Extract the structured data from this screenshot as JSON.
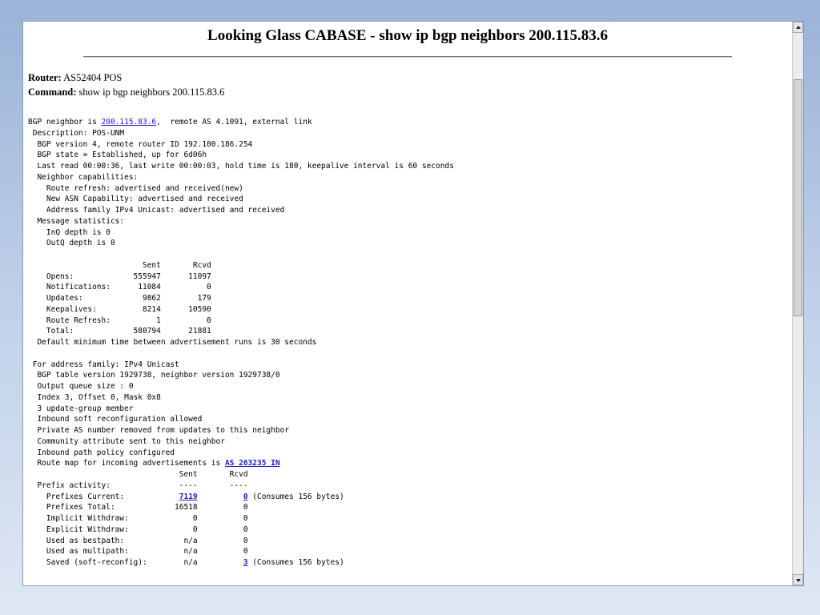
{
  "page": {
    "title": "Looking Glass CABASE - show ip bgp neighbors 200.115.83.6",
    "router_label": "Router:",
    "router_value": " AS52404 POS",
    "command_label": "Command:",
    "command_value": " show ip bgp neighbors 200.115.83.6"
  },
  "links": {
    "neighbor_ip": "200.115.83.6",
    "route_map": "AS 263235 IN",
    "prefixes_current_sent": "7119",
    "prefixes_current_rcvd": "0",
    "saved_rcvd": "3"
  },
  "output": {
    "l0a": "BGP neighbor is ",
    "l0b": ",  remote AS 4.1091, external link",
    "l1": " Description: POS-UNM\n  BGP version 4, remote router ID 192.100.186.254\n  BGP state = Established, up for 6d06h\n  Last read 00:00:36, last write 00:00:03, hold time is 180, keepalive interval is 60 seconds\n  Neighbor capabilities:\n    Route refresh: advertised and received(new)\n    New ASN Capability: advertised and received\n    Address family IPv4 Unicast: advertised and received\n  Message statistics:\n    InQ depth is 0\n    OutQ depth is 0\n\n                         Sent       Rcvd\n    Opens:             555947      11097\n    Notifications:      11084          0\n    Updates:             9862        179\n    Keepalives:          8214      10590\n    Route Refresh:          1          0\n    Total:             580794      21881\n  Default minimum time between advertisement runs is 30 seconds\n\n For address family: IPv4 Unicast\n  BGP table version 1929738, neighbor version 1929738/0\n  Output queue size : 0\n  Index 3, Offset 0, Mask 0x8\n  3 update-group member\n  Inbound soft reconfiguration allowed\n  Private AS number removed from updates to this neighbor\n  Community attribute sent to this neighbor\n  Inbound path policy configured\n  Route map for incoming advertisements is ",
    "l2": "\n                                 Sent       Rcvd\n  Prefix activity:               ----       ----\n    Prefixes Current:            ",
    "l3": "          ",
    "l4": " (Consumes 156 bytes)\n    Prefixes Total:             16518          0\n    Implicit Withdraw:              0          0\n    Explicit Withdraw:              0          0\n    Used as bestpath:             n/a          0\n    Used as multipath:            n/a          0\n    Saved (soft-reconfig):        n/a          ",
    "l5": " (Consumes 156 bytes)"
  },
  "scrollbar": {
    "up_icon": "arrow-up-icon",
    "down_icon": "arrow-down-icon"
  }
}
